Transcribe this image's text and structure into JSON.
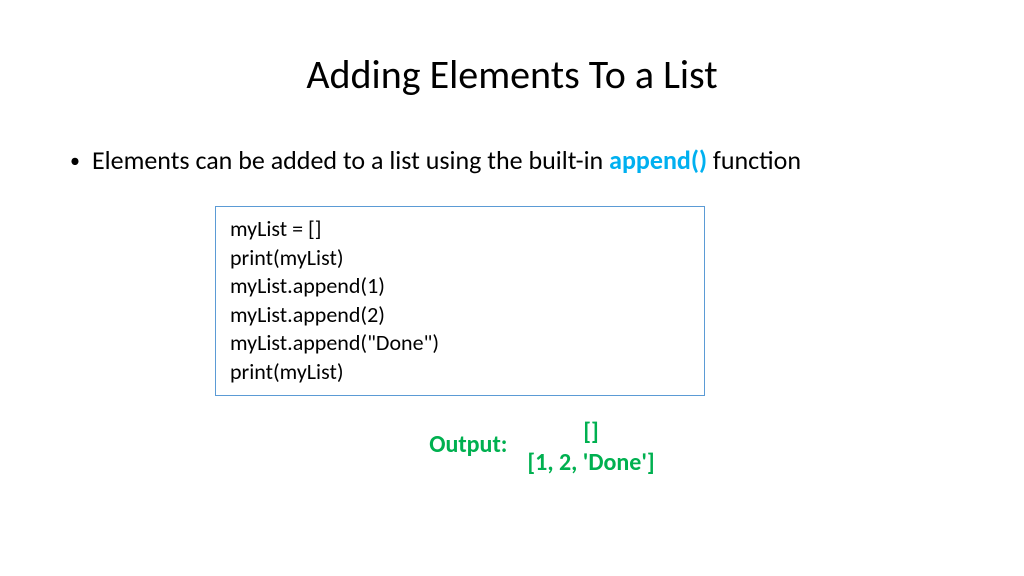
{
  "title": "Adding Elements To a List",
  "bullet": {
    "pre": "Elements can be added to a list using the built-in ",
    "highlight": "append()",
    "post": " function"
  },
  "code": {
    "line1": "myList = []",
    "line2": "print(myList)",
    "line3": "myList.append(1)",
    "line4": "myList.append(2)",
    "line5": "myList.append(\"Done\")",
    "line6": "print(myList)"
  },
  "output": {
    "label": "Output:",
    "line1": "[]",
    "line2": "[1, 2, 'Done']"
  }
}
